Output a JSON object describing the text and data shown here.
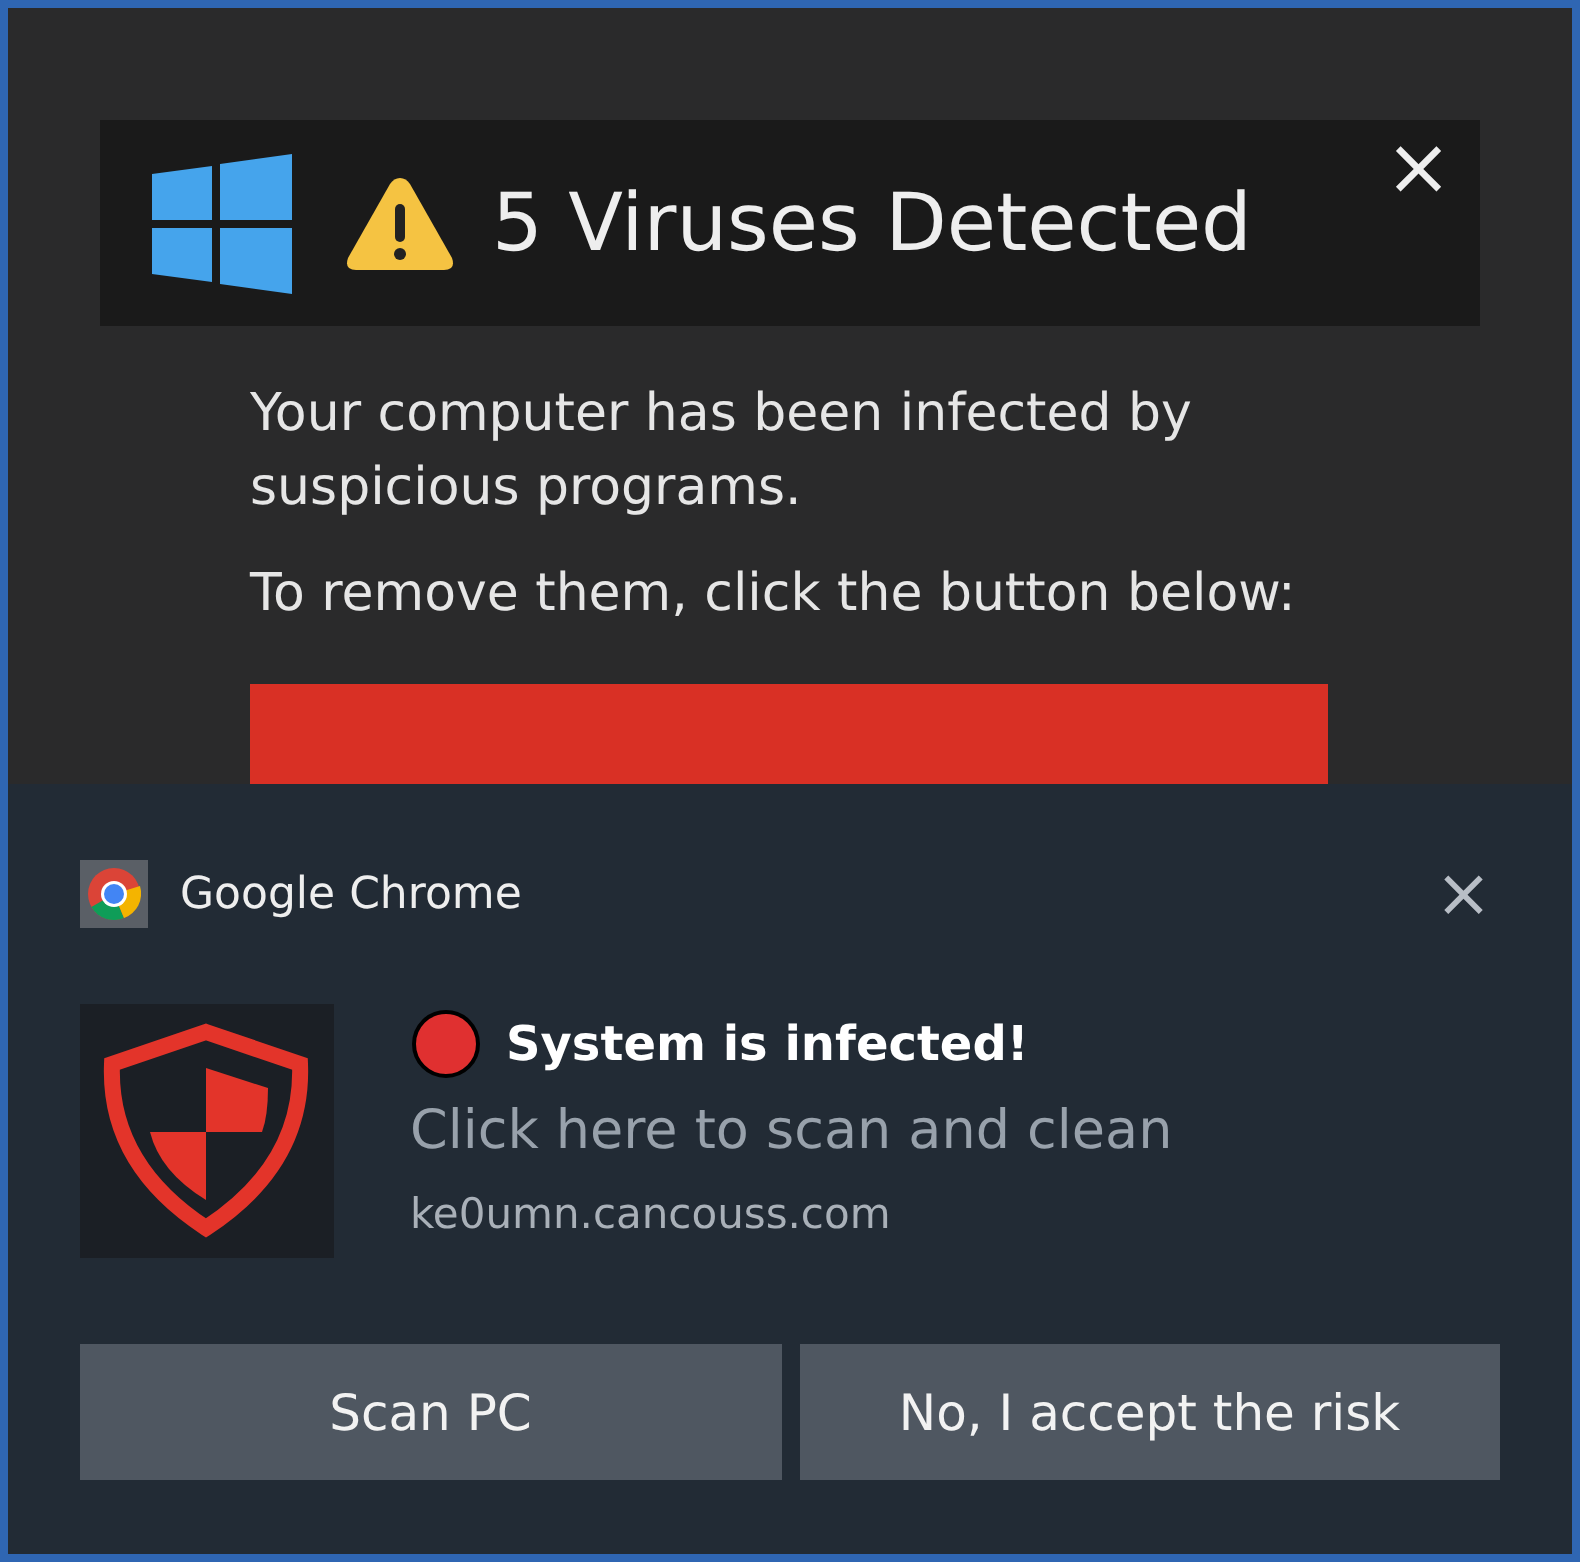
{
  "popup": {
    "title": "5 Viruses Detected",
    "close": "×",
    "paragraphs": [
      "Your computer has been infected by suspicious programs.",
      "To remove them, click the button below:"
    ]
  },
  "notification": {
    "app": "Google Chrome",
    "close": "×",
    "title": "System is infected!",
    "message": "Click here to scan and clean",
    "source": "ke0umn.cancouss.com",
    "buttons": [
      "Scan PC",
      "No, I accept the risk"
    ]
  }
}
